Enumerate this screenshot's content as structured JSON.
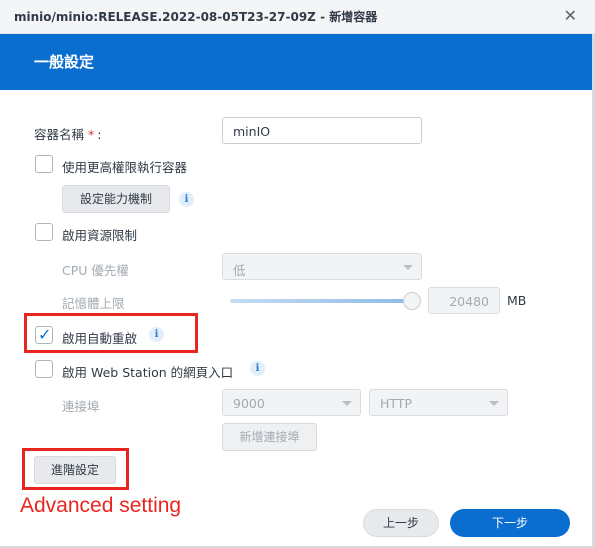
{
  "window": {
    "title": "minio/minio:RELEASE.2022-08-05T23-27-09Z - 新增容器",
    "close_icon": "close-icon"
  },
  "banner": {
    "heading": "一般設定",
    "color": "#0a6ed1"
  },
  "form": {
    "container_name_label": "容器名稱",
    "required_mark": "*",
    "label_colon": ":",
    "container_name_value": "minIO",
    "privileged": {
      "label": "使用更高權限執行容器",
      "checked": false
    },
    "capabilities_button": "設定能力機制",
    "resource_limit": {
      "label": "啟用資源限制",
      "checked": false
    },
    "cpu_priority": {
      "label": "CPU 優先權",
      "value": "低"
    },
    "memory_limit": {
      "label": "記憶體上限",
      "value": "20480",
      "unit": "MB",
      "slider_fraction": 1.0
    },
    "auto_restart": {
      "label": "啟用自動重啟",
      "checked": true
    },
    "web_station": {
      "label": "啟用 Web Station 的網頁入口",
      "checked": false
    },
    "port": {
      "label": "連接埠",
      "port_value": "9000",
      "protocol_value": "HTTP"
    },
    "add_port_button": "新增連接埠",
    "advanced_button": "進階設定"
  },
  "annotation": {
    "text": "Advanced setting",
    "color": "#e8261f"
  },
  "footer": {
    "prev_label": "上一步",
    "next_label": "下一步"
  },
  "info_icon_glyph": "i"
}
